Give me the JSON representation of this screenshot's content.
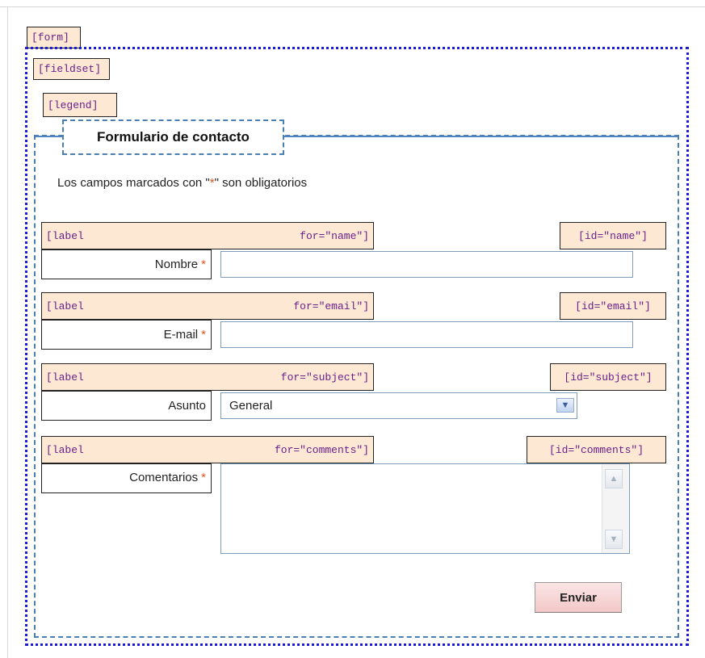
{
  "tags": {
    "form": "[form]",
    "fieldset": "[fieldset]",
    "legend": "[legend]"
  },
  "legend": "Formulario de contacto",
  "intro": {
    "before": "Los campos marcados con \"",
    "marker": "*",
    "after": "\" son obligatorios"
  },
  "fields": [
    {
      "tag_left": "[label",
      "tag_for": "for=\"name\"]",
      "tag_id": "[id=\"name\"]",
      "label": "Nombre",
      "required": "*",
      "type": "text",
      "value": ""
    },
    {
      "tag_left": "[label",
      "tag_for": "for=\"email\"]",
      "tag_id": "[id=\"email\"]",
      "label": "E-mail",
      "required": "*",
      "type": "text",
      "value": ""
    },
    {
      "tag_left": "[label",
      "tag_for": "for=\"subject\"]",
      "tag_id": "[id=\"subject\"]",
      "label": "Asunto",
      "required": "",
      "type": "select",
      "value": "General"
    },
    {
      "tag_left": "[label",
      "tag_for": "for=\"comments\"]",
      "tag_id": "[id=\"comments\"]",
      "label": "Comentarios",
      "required": "*",
      "type": "textarea",
      "value": ""
    }
  ],
  "submit_label": "Enviar",
  "icons": {
    "select_arrow": "chevron-down-icon",
    "scroll_up": "scroll-up-icon",
    "scroll_down": "scroll-down-icon"
  },
  "colors": {
    "form_outline": "#1a1ad8",
    "fieldset_outline": "#4a7fb2",
    "tag_background": "#fde9d3",
    "tag_text": "#6a1f8a",
    "required_marker": "#e0541c"
  }
}
